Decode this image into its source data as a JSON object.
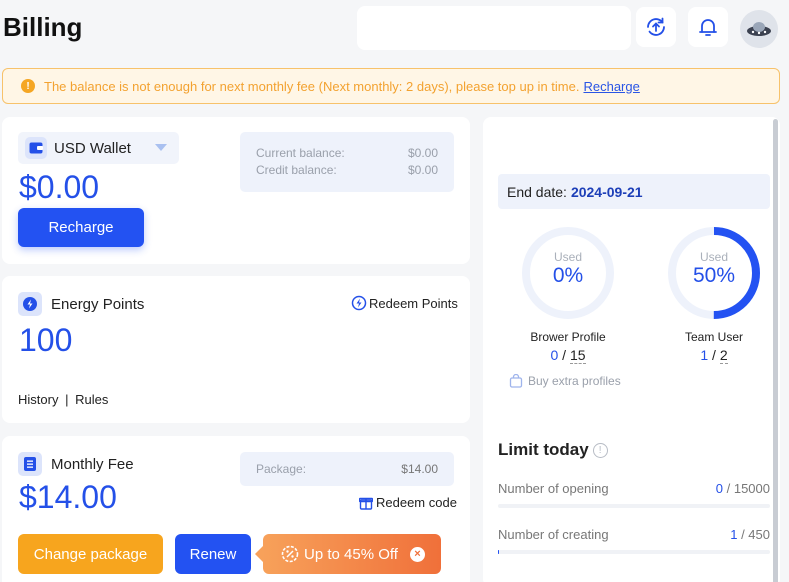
{
  "header": {
    "title": "Billing"
  },
  "alert": {
    "message": "The balance is not enough for next monthly fee (Next monthly: 2 days), please top up in time.",
    "link": "Recharge"
  },
  "wallet": {
    "selector_label": "USD Wallet",
    "amount": "$0.00",
    "current_balance_label": "Current balance:",
    "current_balance_value": "$0.00",
    "credit_balance_label": "Credit balance:",
    "credit_balance_value": "$0.00",
    "recharge_button": "Recharge"
  },
  "energy": {
    "label": "Energy Points",
    "value": "100",
    "redeem_link": "Redeem Points",
    "history_link": "History",
    "separator": "|",
    "rules_link": "Rules"
  },
  "monthly": {
    "label": "Monthly Fee",
    "amount": "$14.00",
    "package_label": "Package:",
    "package_value": "$14.00",
    "redeem_link": "Redeem code",
    "change_button": "Change package",
    "renew_button": "Renew",
    "promo": "Up to 45% Off"
  },
  "subscription": {
    "end_date_label": "End date:",
    "end_date_value": "2024-09-21",
    "profile": {
      "used_label": "Used",
      "percent_text": "0%",
      "percent": 0,
      "label": "Brower Profile",
      "used": "0",
      "slash": "/",
      "total": "15",
      "extra_link": "Buy extra profiles"
    },
    "team": {
      "used_label": "Used",
      "percent_text": "50%",
      "percent": 50,
      "label": "Team User",
      "used": "1",
      "slash": "/",
      "total": "2"
    },
    "limit_title": "Limit today",
    "limits": [
      {
        "label": "Number of opening",
        "used": "0",
        "sep": " / ",
        "total": "15000",
        "fraction": 0
      },
      {
        "label": "Number of creating",
        "used": "1",
        "sep": " / ",
        "total": "450",
        "fraction": 0.002
      }
    ]
  },
  "colors": {
    "primary": "#2352f2",
    "accent_orange": "#f7a51e",
    "warning": "#f3a230"
  }
}
